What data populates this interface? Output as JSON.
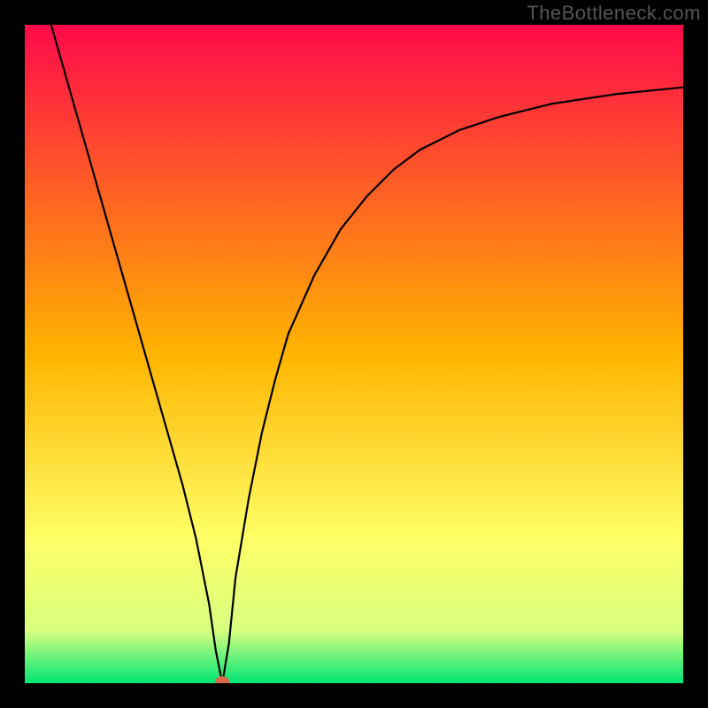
{
  "watermark": "TheBottleneck.com",
  "chart_data": {
    "type": "line",
    "title": "",
    "xlabel": "",
    "ylabel": "",
    "xlim": [
      0,
      100
    ],
    "ylim": [
      0,
      100
    ],
    "background_gradient": {
      "stops": [
        {
          "offset": 0,
          "color": "#ff0a4a"
        },
        {
          "offset": 50,
          "color": "#ffb400"
        },
        {
          "offset": 78,
          "color": "#ffff66"
        },
        {
          "offset": 92,
          "color": "#d8ff80"
        },
        {
          "offset": 100,
          "color": "#00e676"
        }
      ]
    },
    "series": [
      {
        "name": "bottleneck-curve",
        "color": "#000000",
        "x": [
          4,
          6,
          8,
          10,
          12,
          14,
          16,
          18,
          20,
          22,
          24,
          26,
          28,
          29,
          30,
          31,
          32,
          34,
          36,
          38,
          40,
          44,
          48,
          52,
          56,
          60,
          66,
          72,
          80,
          90,
          100
        ],
        "y": [
          100,
          93,
          86,
          79,
          72,
          65,
          58,
          51,
          44,
          37,
          30,
          22,
          12,
          5,
          0,
          6,
          16,
          28,
          38,
          46,
          53,
          62,
          69,
          74,
          78,
          81,
          84,
          86,
          88,
          89.5,
          90.5
        ]
      }
    ],
    "marker": {
      "name": "optimal-point",
      "x": 30,
      "y": 0,
      "color": "#d46a4a",
      "rx": 8,
      "ry": 6
    }
  }
}
